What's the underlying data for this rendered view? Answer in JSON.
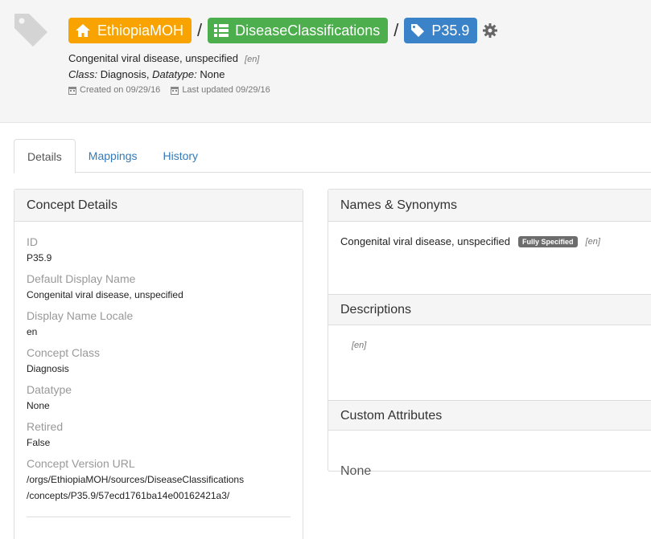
{
  "breadcrumb": {
    "org": "EthiopiaMOH",
    "source": "DiseaseClassifications",
    "concept": "P35.9",
    "separator": "/"
  },
  "header": {
    "name": "Congenital viral disease, unspecified",
    "name_locale": "[en]",
    "class_label": "Class:",
    "class_value": "Diagnosis,",
    "datatype_label": "Datatype:",
    "datatype_value": "None",
    "created": "Created on 09/29/16",
    "updated": "Last updated 09/29/16"
  },
  "tabs": [
    {
      "label": "Details",
      "active": true
    },
    {
      "label": "Mappings",
      "active": false
    },
    {
      "label": "History",
      "active": false
    }
  ],
  "details": {
    "title": "Concept Details",
    "fields": [
      {
        "label": "ID",
        "value": "P35.9"
      },
      {
        "label": "Default Display Name",
        "value": "Congenital viral disease, unspecified"
      },
      {
        "label": "Display Name Locale",
        "value": "en"
      },
      {
        "label": "Concept Class",
        "value": "Diagnosis"
      },
      {
        "label": "Datatype",
        "value": "None"
      },
      {
        "label": "Retired",
        "value": "False"
      },
      {
        "label": "Concept Version URL",
        "value_line1": "/orgs/EthiopiaMOH/sources/DiseaseClassifications",
        "value_line2": "/concepts/P35.9/57ecd1761ba14e00162421a3/"
      }
    ]
  },
  "names": {
    "title": "Names & Synonyms",
    "name": "Congenital viral disease, unspecified",
    "badge": "Fully Specified",
    "locale": "[en]"
  },
  "descriptions": {
    "title": "Descriptions",
    "locale": "[en]"
  },
  "custom_attributes": {
    "title": "Custom Attributes",
    "value": "None"
  },
  "colors": {
    "org": "#f8a300",
    "source": "#4cae4c",
    "concept": "#3a83c8",
    "link": "#337ab7"
  },
  "icons": [
    "tag-icon",
    "home-icon",
    "list-icon",
    "gear-icon",
    "calendar-icon"
  ]
}
